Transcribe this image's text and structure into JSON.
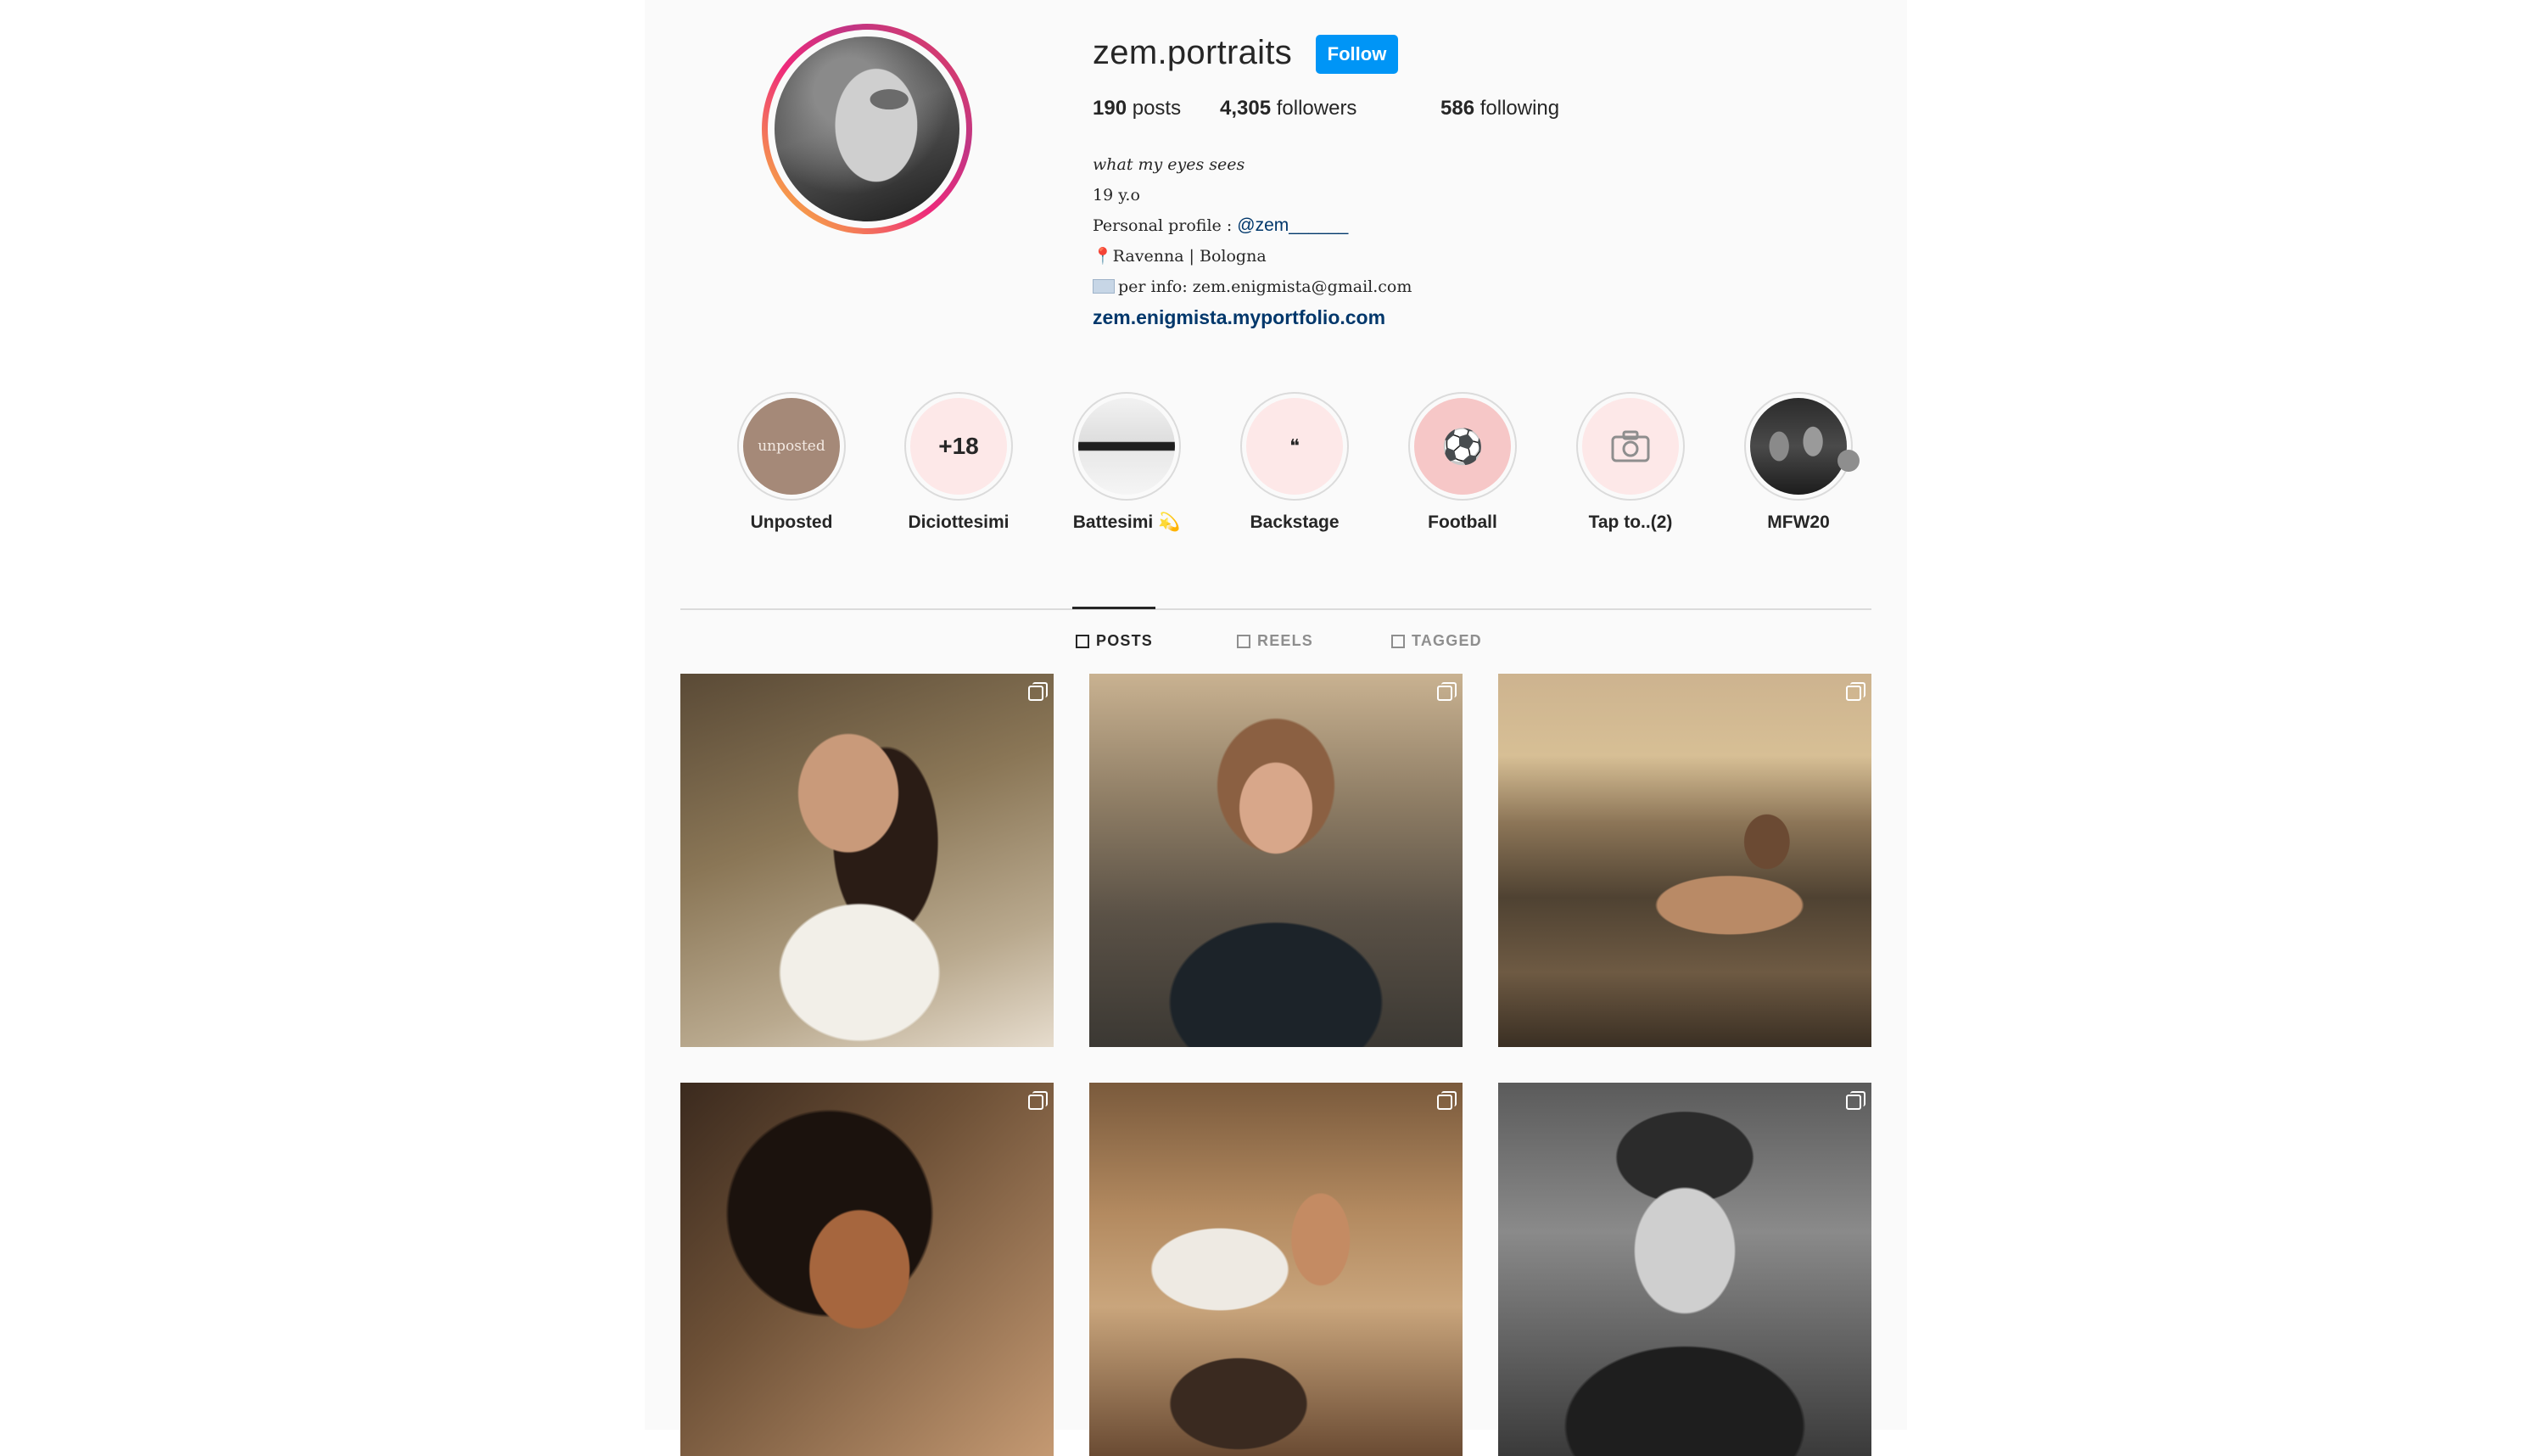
{
  "profile": {
    "username": "zem.portraits",
    "follow_label": "Follow",
    "stats": {
      "posts_count": "190",
      "posts_label": "posts",
      "followers_count": "4,305",
      "followers_label": "followers",
      "following_count": "586",
      "following_label": "following"
    },
    "bio": {
      "tagline": "what my eyes sees",
      "age": "19 y.o",
      "personal_prefix": "Personal profile : ",
      "personal_handle": "@zem______",
      "location_pin": "📍",
      "location": "Ravenna | Bologna",
      "info": "per info: zem.enigmista@gmail.com",
      "website": "zem.enigmista.myportfolio.com"
    }
  },
  "highlights": [
    {
      "label": "Unposted",
      "cover_text": "unposted"
    },
    {
      "label": "Diciottesimi",
      "cover_text": "+18"
    },
    {
      "label": "Battesimi 💫",
      "cover_text": ""
    },
    {
      "label": "Backstage",
      "cover_text": "❝"
    },
    {
      "label": "Football",
      "cover_text": "⚽"
    },
    {
      "label": "Tap to..(2)",
      "cover_text": ""
    },
    {
      "label": "MFW20",
      "cover_text": ""
    }
  ],
  "tabs": [
    {
      "label": "POSTS",
      "active": true
    },
    {
      "label": "REELS",
      "active": false
    },
    {
      "label": "TAGGED",
      "active": false
    }
  ],
  "colors": {
    "accent": "#0095f6",
    "link": "#00376b",
    "background": "#fafafa"
  }
}
